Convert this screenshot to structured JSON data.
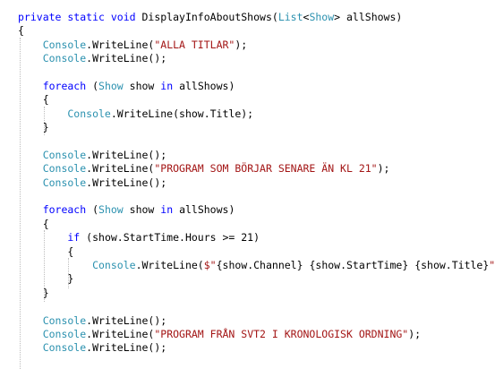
{
  "code": {
    "lines": [
      [
        {
          "t": "private static void ",
          "c": "kw"
        },
        {
          "t": "DisplayInfoAboutShows(",
          "c": ""
        },
        {
          "t": "List",
          "c": "ty"
        },
        {
          "t": "<",
          "c": ""
        },
        {
          "t": "Show",
          "c": "ty"
        },
        {
          "t": "> allShows)",
          "c": ""
        }
      ],
      [
        {
          "t": "{",
          "c": ""
        }
      ],
      [
        {
          "t": "    Console",
          "c": "ty"
        },
        {
          "t": ".WriteLine(",
          "c": ""
        },
        {
          "t": "\"ALLA TITLAR\"",
          "c": "str"
        },
        {
          "t": ");",
          "c": ""
        }
      ],
      [
        {
          "t": "    Console",
          "c": "ty"
        },
        {
          "t": ".WriteLine();",
          "c": ""
        }
      ],
      [],
      [
        {
          "t": "    foreach",
          "c": "kw"
        },
        {
          "t": " (",
          "c": ""
        },
        {
          "t": "Show",
          "c": "ty"
        },
        {
          "t": " show ",
          "c": ""
        },
        {
          "t": "in",
          "c": "kw"
        },
        {
          "t": " allShows)",
          "c": ""
        }
      ],
      [
        {
          "t": "    {",
          "c": ""
        }
      ],
      [
        {
          "t": "        Console",
          "c": "ty"
        },
        {
          "t": ".WriteLine(show.Title);",
          "c": ""
        }
      ],
      [
        {
          "t": "    }",
          "c": ""
        }
      ],
      [],
      [
        {
          "t": "    Console",
          "c": "ty"
        },
        {
          "t": ".WriteLine();",
          "c": ""
        }
      ],
      [
        {
          "t": "    Console",
          "c": "ty"
        },
        {
          "t": ".WriteLine(",
          "c": ""
        },
        {
          "t": "\"PROGRAM SOM BÖRJAR SENARE ÄN KL 21\"",
          "c": "str"
        },
        {
          "t": ");",
          "c": ""
        }
      ],
      [
        {
          "t": "    Console",
          "c": "ty"
        },
        {
          "t": ".WriteLine();",
          "c": ""
        }
      ],
      [],
      [
        {
          "t": "    foreach",
          "c": "kw"
        },
        {
          "t": " (",
          "c": ""
        },
        {
          "t": "Show",
          "c": "ty"
        },
        {
          "t": " show ",
          "c": ""
        },
        {
          "t": "in",
          "c": "kw"
        },
        {
          "t": " allShows)",
          "c": ""
        }
      ],
      [
        {
          "t": "    {",
          "c": ""
        }
      ],
      [
        {
          "t": "        if",
          "c": "kw"
        },
        {
          "t": " (show.StartTime.Hours >= 21)",
          "c": ""
        }
      ],
      [
        {
          "t": "        {",
          "c": ""
        }
      ],
      [
        {
          "t": "            Console",
          "c": "ty"
        },
        {
          "t": ".WriteLine(",
          "c": ""
        },
        {
          "t": "$\"",
          "c": "str"
        },
        {
          "t": "{show.Channel}",
          "c": ""
        },
        {
          "t": " ",
          "c": "str"
        },
        {
          "t": "{show.StartTime}",
          "c": ""
        },
        {
          "t": " ",
          "c": "str"
        },
        {
          "t": "{show.Title}",
          "c": ""
        },
        {
          "t": "\"",
          "c": "str"
        },
        {
          "t": ");",
          "c": ""
        }
      ],
      [
        {
          "t": "        }",
          "c": ""
        }
      ],
      [
        {
          "t": "    }",
          "c": ""
        }
      ],
      [],
      [
        {
          "t": "    Console",
          "c": "ty"
        },
        {
          "t": ".WriteLine();",
          "c": ""
        }
      ],
      [
        {
          "t": "    Console",
          "c": "ty"
        },
        {
          "t": ".WriteLine(",
          "c": ""
        },
        {
          "t": "\"PROGRAM FRÅN SVT2 I KRONOLOGISK ORDNING\"",
          "c": "str"
        },
        {
          "t": ");",
          "c": ""
        }
      ],
      [
        {
          "t": "    Console",
          "c": "ty"
        },
        {
          "t": ".WriteLine();",
          "c": ""
        }
      ]
    ]
  }
}
